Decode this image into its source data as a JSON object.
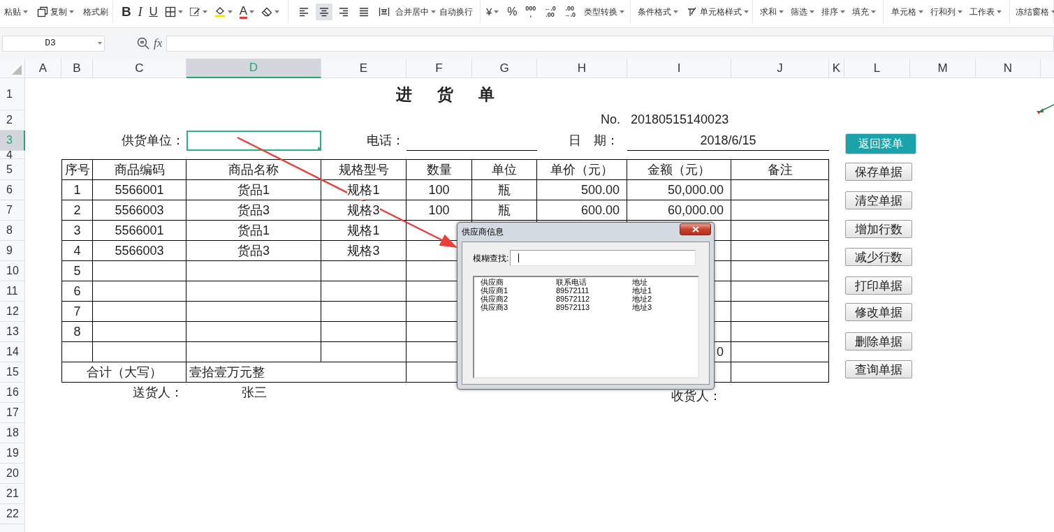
{
  "ribbon": {
    "groups": [
      [
        {
          "kind": "text",
          "label": "粘贴",
          "dropdown": true
        },
        {
          "kind": "icon",
          "label": "复制",
          "dropdown": true
        },
        {
          "kind": "text",
          "label": "格式刷",
          "dropdown": false
        }
      ],
      [
        {
          "kind": "glyph",
          "label": "B"
        },
        {
          "kind": "glyph",
          "label": "I"
        },
        {
          "kind": "glyph",
          "label": "U"
        },
        {
          "kind": "icon",
          "dropdown": true
        },
        {
          "kind": "icon",
          "dropdown": true
        },
        {
          "kind": "icon",
          "dropdown": true
        },
        {
          "kind": "glyph",
          "label": "A",
          "dropdown": true
        },
        {
          "kind": "icon",
          "dropdown": true
        }
      ],
      [
        {
          "kind": "align",
          "selected": false
        },
        {
          "kind": "align",
          "selected": true
        },
        {
          "kind": "align",
          "selected": false
        },
        {
          "kind": "align",
          "selected": false
        },
        {
          "kind": "align",
          "selected": false
        },
        {
          "kind": "text",
          "label": "合并居中",
          "dropdown": true
        },
        {
          "kind": "text",
          "label": "自动换行",
          "dropdown": false
        }
      ],
      [
        {
          "kind": "glyph",
          "label": "¥",
          "dropdown": true
        },
        {
          "kind": "glyph",
          "label": "%"
        },
        {
          "kind": "stack",
          "lines": [
            "000",
            ","
          ]
        },
        {
          "kind": "stack",
          "lines": [
            "←.0",
            ".00"
          ]
        },
        {
          "kind": "stack",
          "lines": [
            ".00",
            "→.0"
          ]
        },
        {
          "kind": "text",
          "label": "类型转换",
          "dropdown": true
        }
      ],
      [
        {
          "kind": "text",
          "label": "条件格式",
          "dropdown": true
        },
        {
          "kind": "icon",
          "label": "单元格样式",
          "dropdown": true
        }
      ],
      [
        {
          "kind": "text",
          "label": "求和",
          "dropdown": true
        },
        {
          "kind": "text",
          "label": "筛选",
          "dropdown": true
        },
        {
          "kind": "text",
          "label": "排序",
          "dropdown": true
        },
        {
          "kind": "text",
          "label": "填充",
          "dropdown": true
        }
      ],
      [
        {
          "kind": "text",
          "label": "单元格",
          "dropdown": true
        },
        {
          "kind": "text",
          "label": "行和列",
          "dropdown": true
        },
        {
          "kind": "text",
          "label": "工作表",
          "dropdown": true
        }
      ],
      [
        {
          "kind": "text",
          "label": "冻结窗格",
          "dropdown": true
        }
      ]
    ]
  },
  "formula_bar": {
    "name_box": "D3",
    "fx": "fx"
  },
  "columns": [
    {
      "label": "A",
      "selected": false
    },
    {
      "label": "B",
      "selected": false
    },
    {
      "label": "C",
      "selected": false
    },
    {
      "label": "D",
      "selected": true
    },
    {
      "label": "E",
      "selected": false
    },
    {
      "label": "F",
      "selected": false
    },
    {
      "label": "G",
      "selected": false
    },
    {
      "label": "H",
      "selected": false
    },
    {
      "label": "I",
      "selected": false
    },
    {
      "label": "J",
      "selected": false
    },
    {
      "label": "K",
      "selected": false
    },
    {
      "label": "L",
      "selected": false
    },
    {
      "label": "M",
      "selected": false
    },
    {
      "label": "N",
      "selected": false
    }
  ],
  "rows": [
    {
      "label": "1",
      "selected": false
    },
    {
      "label": "2",
      "selected": false
    },
    {
      "label": "3",
      "selected": true
    },
    {
      "label": "4",
      "selected": false
    },
    {
      "label": "5",
      "selected": false
    },
    {
      "label": "6",
      "selected": false
    },
    {
      "label": "7",
      "selected": false
    },
    {
      "label": "8",
      "selected": false
    },
    {
      "label": "9",
      "selected": false
    },
    {
      "label": "10",
      "selected": false
    },
    {
      "label": "11",
      "selected": false
    },
    {
      "label": "12",
      "selected": false
    },
    {
      "label": "13",
      "selected": false
    },
    {
      "label": "14",
      "selected": false
    },
    {
      "label": "15",
      "selected": false
    },
    {
      "label": "16",
      "selected": false
    },
    {
      "label": "17",
      "selected": false
    },
    {
      "label": "18",
      "selected": false
    },
    {
      "label": "19",
      "selected": false
    },
    {
      "label": "20",
      "selected": false
    },
    {
      "label": "21",
      "selected": false
    },
    {
      "label": "22",
      "selected": false
    }
  ],
  "sheet": {
    "title": "进货单",
    "no_label": "No.",
    "no_value": "20180515140023",
    "supplier_label": "供货单位：",
    "supplier_cell": {
      "selected": true
    },
    "phone_label": "电话：",
    "date_label": "日　期：",
    "date_value": "2018/6/15",
    "table": {
      "columns": [
        "序号",
        "商品编码",
        "商品名称",
        "规格型号",
        "数量",
        "单位",
        "单价（元）",
        "金额（元）",
        "备注"
      ],
      "rows": [
        {
          "no": "1",
          "code": "5566001",
          "name": "货品1",
          "spec": "规格1",
          "qty": "100",
          "unit": "瓶",
          "price": "500.00",
          "amount": "50,000.00"
        },
        {
          "no": "2",
          "code": "5566003",
          "name": "货品3",
          "spec": "规格3",
          "qty": "100",
          "unit": "瓶",
          "price": "600.00",
          "amount": "60,000.00"
        },
        {
          "no": "3",
          "code": "5566001",
          "name": "货品1",
          "spec": "规格1"
        },
        {
          "no": "4",
          "code": "5566003",
          "name": "货品3",
          "spec": "规格3"
        },
        {
          "no": "5"
        },
        {
          "no": "6"
        },
        {
          "no": "7"
        },
        {
          "no": "8"
        },
        {
          "amount": "0"
        }
      ]
    },
    "total_label": "合计（大写）",
    "total_value": "壹拾壹万元整",
    "deliverer_label": "送货人：",
    "deliverer": "张三",
    "receiver_label": "收货人："
  },
  "side_buttons": [
    {
      "label": "返回菜单",
      "kind": "primary"
    },
    {
      "label": "保存单据",
      "kind": "normal"
    },
    {
      "label": "清空单据",
      "kind": "normal"
    },
    {
      "label": "增加行数",
      "kind": "normal"
    },
    {
      "label": "减少行数",
      "kind": "normal"
    },
    {
      "label": "打印单据",
      "kind": "normal"
    },
    {
      "label": "修改单据",
      "kind": "normal"
    },
    {
      "label": "删除单据",
      "kind": "normal"
    },
    {
      "label": "查询单据",
      "kind": "normal"
    }
  ],
  "dialog": {
    "title": "供应商信息",
    "search_label": "模糊查找:",
    "list": {
      "header": [
        "供应商",
        "联系电话",
        "地址"
      ],
      "rows": [
        [
          "供应商1",
          "89572111",
          "地址1"
        ],
        [
          "供应商2",
          "89572112",
          "地址2"
        ],
        [
          "供应商3",
          "89572113",
          "地址3"
        ]
      ]
    }
  }
}
